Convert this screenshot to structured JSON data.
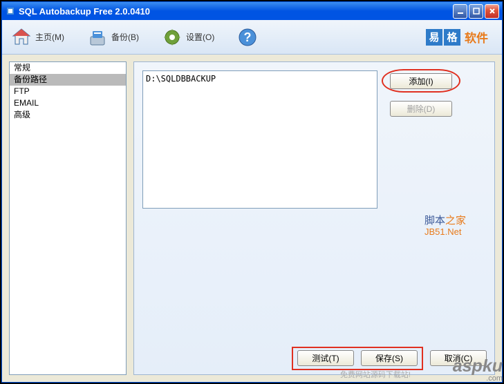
{
  "window": {
    "title": "SQL Autobackup Free 2.0.0410"
  },
  "toolbar": {
    "home": "主页(M)",
    "backup": "备份(B)",
    "settings": "设置(O)"
  },
  "brand": {
    "char1": "易",
    "char2": "格",
    "text": "软件"
  },
  "sidebar": {
    "items": [
      {
        "label": "常规",
        "selected": false
      },
      {
        "label": "备份路径",
        "selected": true
      },
      {
        "label": "FTP",
        "selected": false
      },
      {
        "label": "EMAIL",
        "selected": false
      },
      {
        "label": "高级",
        "selected": false
      }
    ]
  },
  "paths": {
    "items": [
      "D:\\SQLDBBACKUP"
    ]
  },
  "buttons": {
    "add": "添加(I)",
    "delete": "删除(D)",
    "test": "测试(T)",
    "save": "保存(S)",
    "cancel": "取消(C)"
  },
  "watermarks": {
    "jbzj_cn": "脚本",
    "jbzj_or": "之家",
    "jb51": "JB51.Net",
    "aspku": "aspku",
    "aspku_sub": ".com",
    "aspku_desc": "免费网站源码下载站!"
  }
}
